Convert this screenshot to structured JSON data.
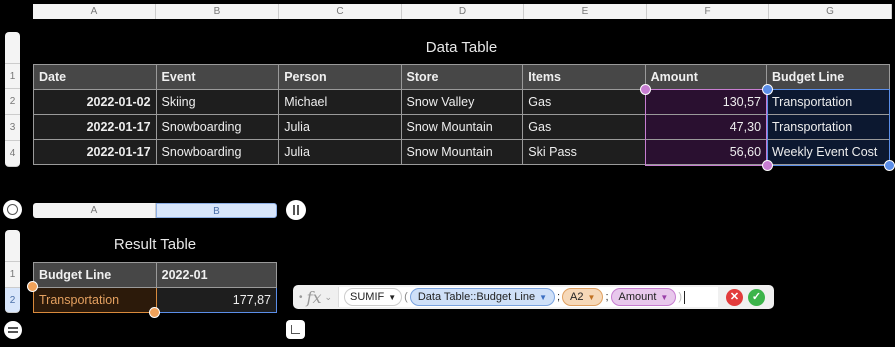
{
  "data_table": {
    "title": "Data Table",
    "column_letters": [
      "A",
      "B",
      "C",
      "D",
      "E",
      "F",
      "G"
    ],
    "row_numbers": [
      "1",
      "2",
      "3",
      "4"
    ],
    "headers": [
      "Date",
      "Event",
      "Person",
      "Store",
      "Items",
      "Amount",
      "Budget Line"
    ],
    "rows": [
      [
        "2022-01-02",
        "Skiing",
        "Michael",
        "Snow Valley",
        "Gas",
        "130,57",
        "Transportation"
      ],
      [
        "2022-01-17",
        "Snowboarding",
        "Julia",
        "Snow Mountain",
        "Gas",
        "47,30",
        "Transportation"
      ],
      [
        "2022-01-17",
        "Snowboarding",
        "Julia",
        "Snow Mountain",
        "Ski Pass",
        "56,60",
        "Weekly Event Cost"
      ]
    ]
  },
  "result_table": {
    "title": "Result Table",
    "column_letters": [
      "A",
      "B"
    ],
    "row_numbers": [
      "1",
      "2"
    ],
    "headers": [
      "Budget Line",
      "2022-01"
    ],
    "rows": [
      [
        "Transportation",
        "177,87"
      ]
    ]
  },
  "formula_bar": {
    "fx": "fx",
    "function": "SUMIF",
    "tokens": [
      {
        "label": "Data Table::Budget Line",
        "color": "#cfe0f8"
      },
      {
        "label": "A2",
        "color": "#f6d8b8"
      },
      {
        "label": "Amount",
        "color": "#e8c8ec"
      }
    ],
    "separator": ";"
  },
  "colors": {
    "amount_ref": "#c77dd1",
    "budget_ref": "#5b8ee8",
    "a2_ref": "#f0a25a"
  }
}
